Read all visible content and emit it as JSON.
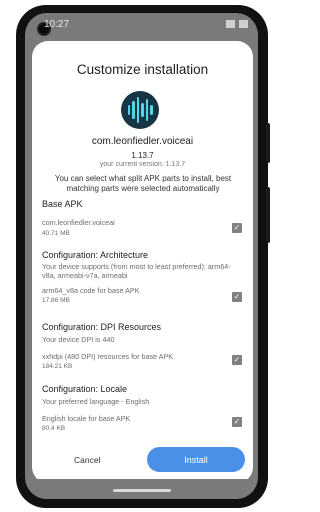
{
  "status_bar": {
    "time": "10:27"
  },
  "dialog": {
    "title": "Customize installation",
    "package": "com.leonfiedler.voiceai",
    "version": "1.13.7",
    "current_version": "your current version: 1.13.7",
    "description": "You can select what split APK parts to install, best matching parts were selected automatically",
    "sections": [
      {
        "title": "Base APK",
        "subtitle": "",
        "item_label": "com.leonfiedler.voiceai",
        "item_size": "40.71 MB",
        "checked": true
      },
      {
        "title": "Configuration: Architecture",
        "subtitle": "Your device supports (from most to least preferred): arm64-v8a, armeabi-v7a, armeabi",
        "item_label": "arm64_v8a code for base APK",
        "item_size": "17.86 MB",
        "checked": true
      },
      {
        "title": "Configuration: DPI Resources",
        "subtitle": "Your device DPI is 440",
        "item_label": "xxhdpi (480 DPI) resources for base APK",
        "item_size": "184.21 KB",
        "checked": true
      },
      {
        "title": "Configuration: Locale",
        "subtitle": "Your preferred language - English",
        "item_label": "English locale for base APK",
        "item_size": "80.4 KB",
        "checked": true
      }
    ],
    "cancel_label": "Cancel",
    "install_label": "Install"
  },
  "colors": {
    "accent": "#4a8fe8",
    "icon_bg": "#173545",
    "icon_wave": "#53d6e6",
    "checkbox": "#808080"
  },
  "icons": [
    "camera-icon",
    "app-waveform-icon",
    "checkbox-checked-icon"
  ]
}
